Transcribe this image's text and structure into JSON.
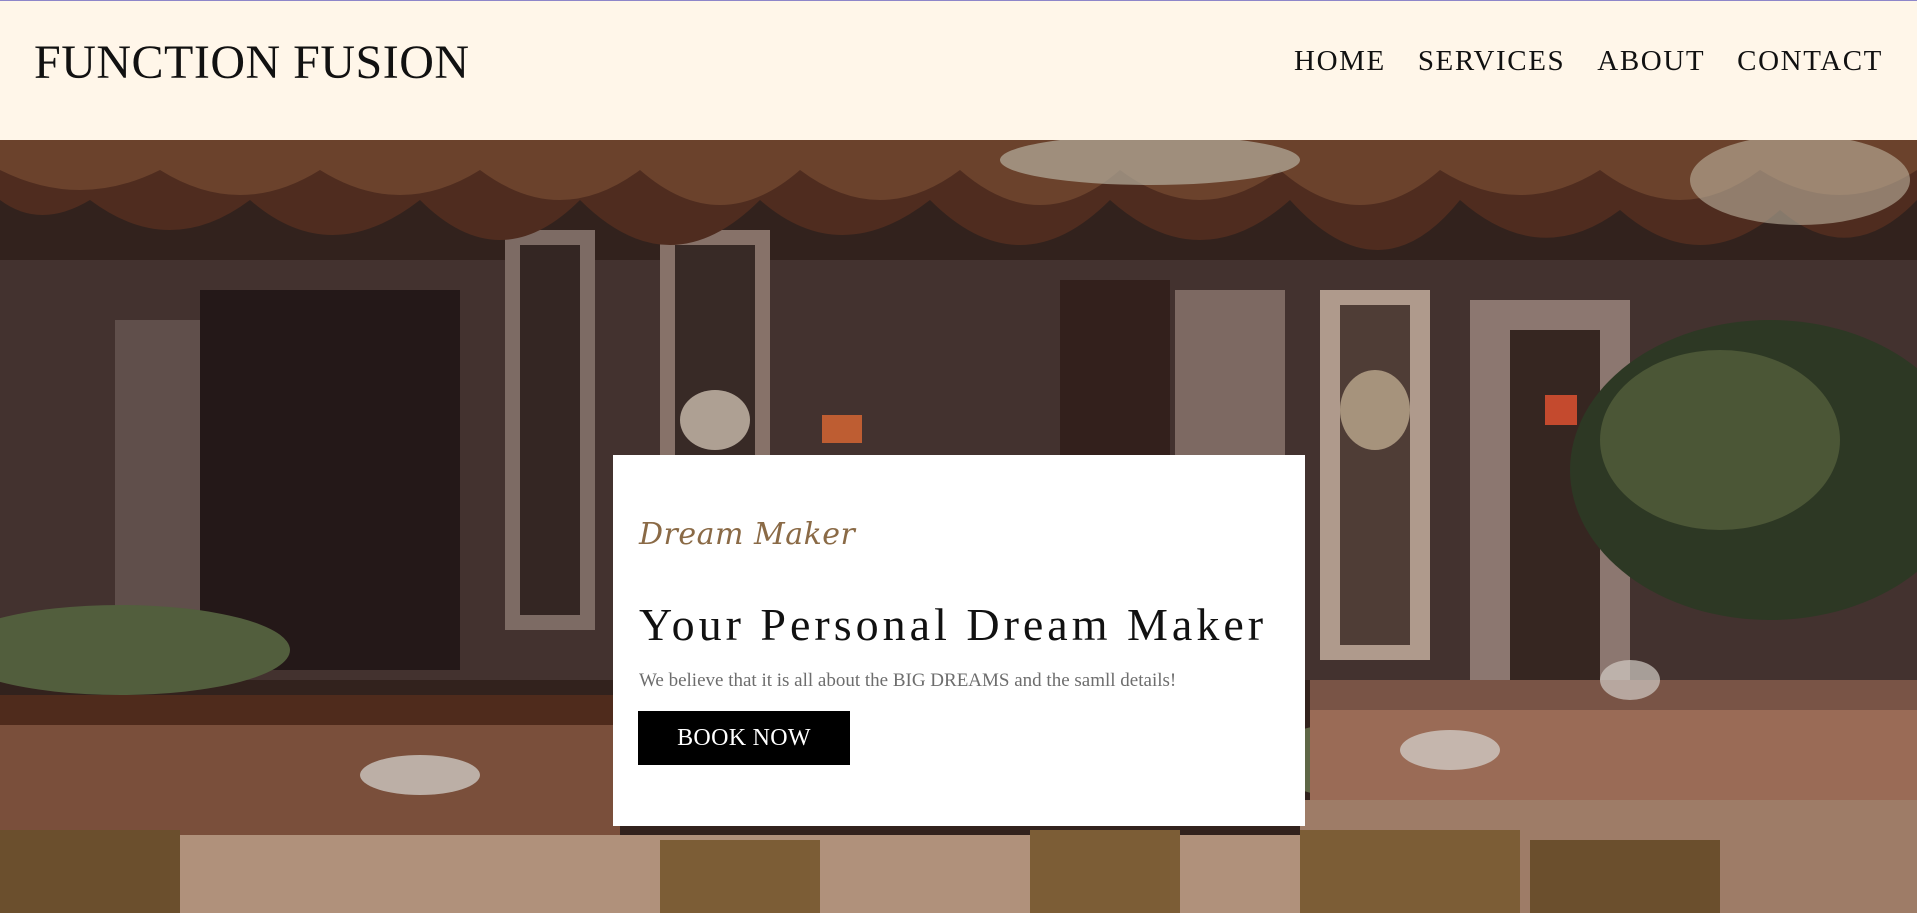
{
  "brand": "FUNCTION FUSION",
  "nav": [
    {
      "label": "HOME"
    },
    {
      "label": "SERVICES"
    },
    {
      "label": "ABOUT"
    },
    {
      "label": "CONTACT"
    }
  ],
  "hero": {
    "tagline": "Dream Maker",
    "title": "Your Personal Dream Maker",
    "subtitle": "We believe that it is all about the BIG DREAMS and the samll details!",
    "cta_label": "BOOK NOW"
  },
  "colors": {
    "header_bg": "#fff6e9",
    "accent_gold": "#8a6a46",
    "button_bg": "#000000"
  }
}
